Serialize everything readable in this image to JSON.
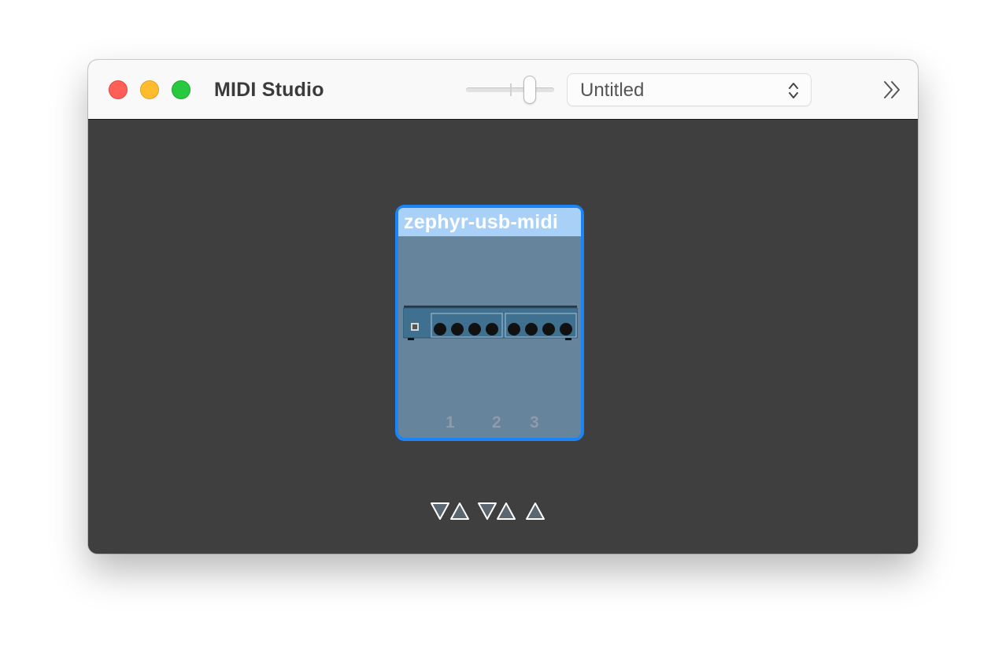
{
  "window": {
    "title": "MIDI Studio"
  },
  "toolbar": {
    "configuration": {
      "value": "Untitled",
      "icon": "chevron-up-down-icon"
    },
    "overflow_icon": "double-chevron-right-icon"
  },
  "device": {
    "name": "zephyr-usb-midi",
    "image_icon": "midi-interface-icon",
    "ports": [
      {
        "number": "1",
        "arrows": [
          "down",
          "up"
        ]
      },
      {
        "number": "2",
        "arrows": [
          "down",
          "up"
        ]
      },
      {
        "number": "3",
        "arrows": [
          "up"
        ]
      }
    ]
  },
  "colors": {
    "selection": "#1b84f6",
    "device_body": "#66849b",
    "canvas": "#3f3f3f"
  }
}
